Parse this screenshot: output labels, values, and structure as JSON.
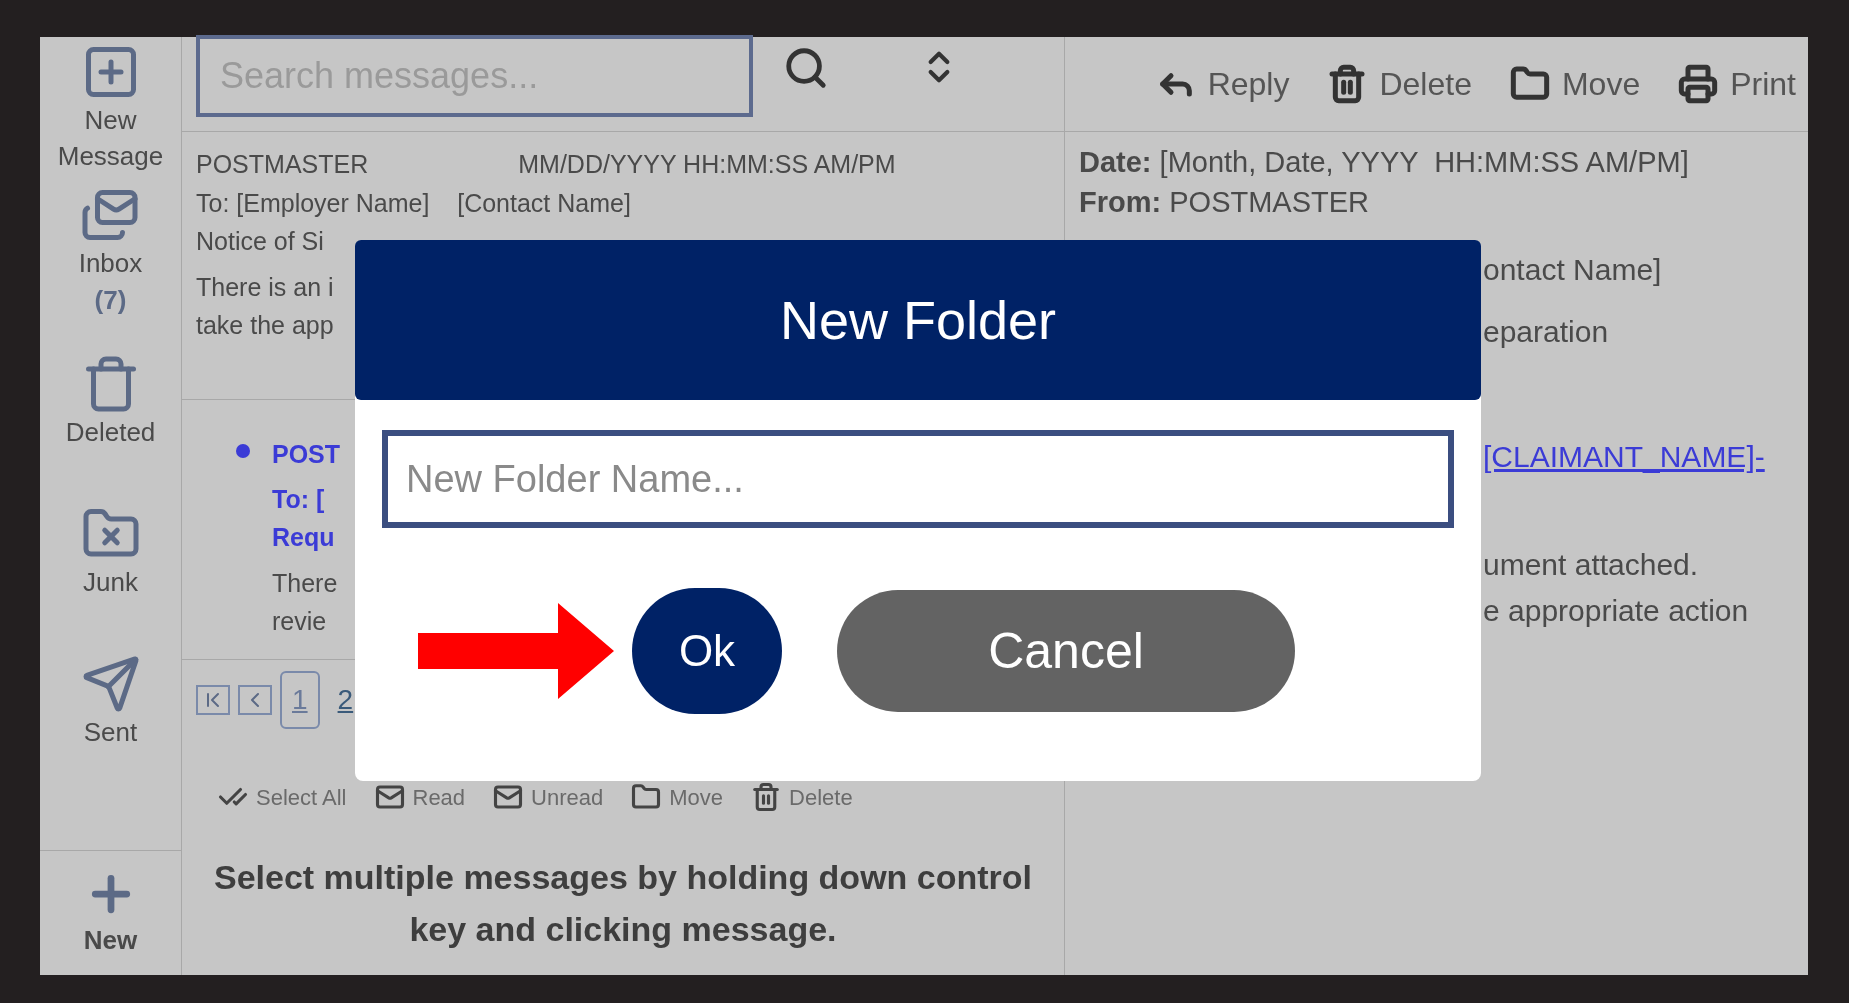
{
  "sidebar": {
    "items": [
      {
        "kind": "compose",
        "label": "New Message"
      },
      {
        "kind": "inbox",
        "label": "Inbox",
        "count": "(7)"
      },
      {
        "kind": "deleted",
        "label": "Deleted"
      },
      {
        "kind": "junk",
        "label": "Junk"
      },
      {
        "kind": "sent",
        "label": "Sent"
      }
    ],
    "new_button": "New"
  },
  "search": {
    "placeholder": "Search messages..."
  },
  "messages": [
    {
      "unread": false,
      "from": "POSTMASTER",
      "date": "MM/DD/YYYY HH:MM:SS  AM/PM",
      "to": "To: [Employer Name]    [Contact Name]",
      "subject": "Notice of Si",
      "preview": [
        "There is an i",
        "take the app"
      ]
    },
    {
      "unread": true,
      "from": "POST",
      "to": "To: [",
      "subject": "Requ",
      "preview": [
        "There",
        "revie"
      ]
    }
  ],
  "pagination": [
    {
      "label": "1",
      "selected": true
    },
    {
      "label": "2",
      "selected": false
    }
  ],
  "bulk_actions": [
    {
      "kind": "select_all",
      "label": "Select All"
    },
    {
      "kind": "read",
      "label": "Read"
    },
    {
      "kind": "unread",
      "label": "Unread"
    },
    {
      "kind": "move",
      "label": "Move"
    },
    {
      "kind": "delete",
      "label": "Delete"
    }
  ],
  "hint": "Select multiple messages by holding down control key and clicking message.",
  "reader": {
    "actions": [
      {
        "kind": "reply",
        "label": "Reply"
      },
      {
        "kind": "delete",
        "label": "Delete"
      },
      {
        "kind": "move",
        "label": "Move"
      },
      {
        "kind": "print",
        "label": "Print"
      }
    ],
    "date_label": "Date:",
    "date": "[Month, Date, YYYY  HH:MM:SS AM/PM]",
    "from_label": "From:",
    "from": "POSTMASTER",
    "lines": [
      {
        "kind": "text",
        "text": "ontact Name]"
      },
      {
        "kind": "text",
        "text": "eparation"
      },
      {
        "kind": "link",
        "text": "[CLAIMANT_NAME]-"
      },
      {
        "kind": "text",
        "text": "ument attached."
      },
      {
        "kind": "text",
        "text": "e appropriate action"
      }
    ]
  },
  "dialog": {
    "title": "New Folder",
    "input": {
      "placeholder": "New Folder Name..."
    },
    "buttons": [
      {
        "kind": "primary",
        "label": "Ok"
      },
      {
        "kind": "secondary",
        "label": "Cancel"
      }
    ]
  }
}
